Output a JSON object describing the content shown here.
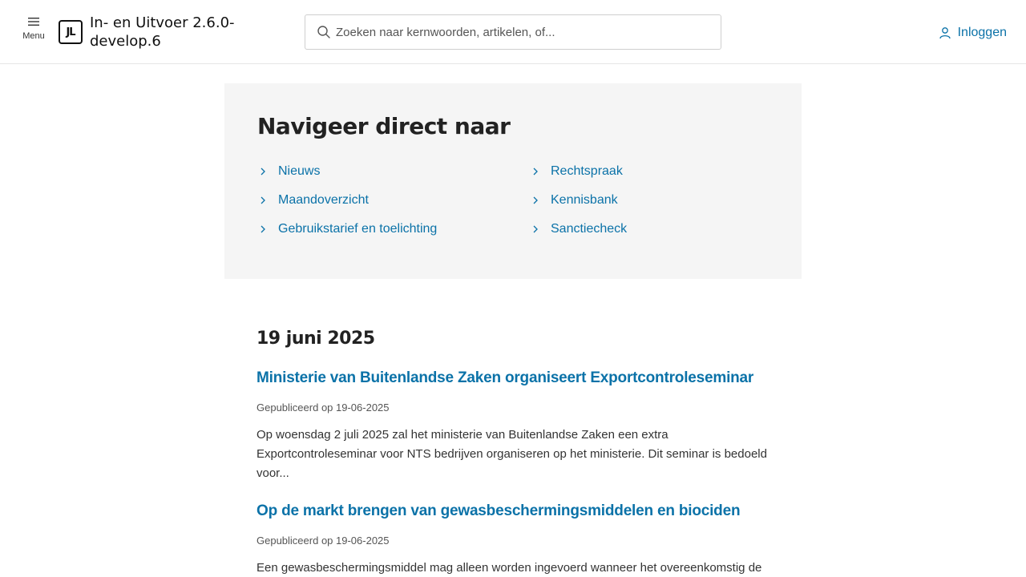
{
  "header": {
    "menu_label": "Menu",
    "logo_text": "JL",
    "app_title": "In- en Uitvoer 2.6.0-develop.6",
    "search_placeholder": "Zoeken naar kernwoorden, artikelen, of...",
    "login_label": "Inloggen"
  },
  "navigate": {
    "title": "Navigeer direct naar",
    "links_left": [
      "Nieuws",
      "Maandoverzicht",
      "Gebruikstarief en toelichting"
    ],
    "links_right": [
      "Rechtspraak",
      "Kennisbank",
      "Sanctiecheck"
    ]
  },
  "news": {
    "date_heading": "19 juni 2025",
    "articles": [
      {
        "title": "Ministerie van Buitenlandse Zaken organiseert Exportcontroleseminar",
        "meta": "Gepubliceerd op 19-06-2025",
        "excerpt": "Op woensdag 2 juli 2025 zal het ministerie van Buitenlandse Zaken een extra Exportcontroleseminar voor NTS bedrijven organiseren op het ministerie. Dit seminar is bedoeld voor..."
      },
      {
        "title": "Op de markt brengen van gewasbeschermingsmiddelen en biociden",
        "meta": "Gepubliceerd op 19-06-2025",
        "excerpt": "Een gewasbeschermingsmiddel mag alleen worden ingevoerd wanneer het overeenkomstig de"
      }
    ]
  },
  "colors": {
    "link": "#0b72a8",
    "panel_bg": "#f5f5f5",
    "text": "#222222"
  }
}
